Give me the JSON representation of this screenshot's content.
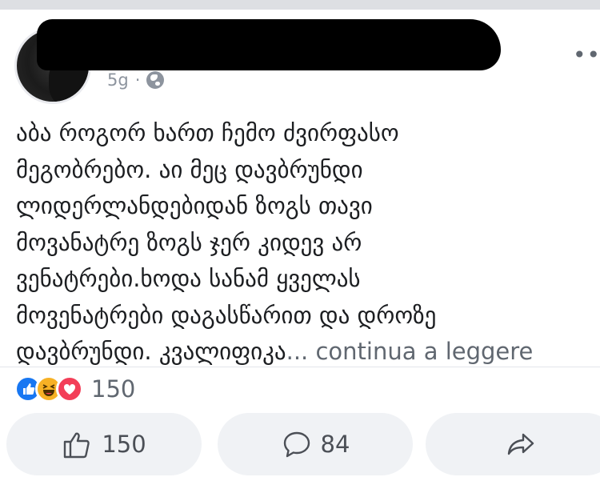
{
  "post": {
    "time": "5g",
    "separator": "·",
    "more_label": "••",
    "text_lines": [
      "აბა როგორ ხართ ჩემო ძვირფასო",
      "მეგობრებო. აი მეც  დავბრუნდი",
      "ლიდერლანდებიდან ზოგს თავი",
      "მოვანატრე ზოგს ჯერ კიდევ არ",
      "ვენატრები.ხოდა სანამ ყველას",
      "მოვენატრები დაგასწარით და დროზე",
      "დავბრუნდი. კვალიფიკა"
    ],
    "ellipsis": "...",
    "see_more": " continua a leggere"
  },
  "reactions": {
    "types": [
      "like-icon",
      "haha-icon",
      "love-icon"
    ],
    "count": "150"
  },
  "actions": {
    "like_count": "150",
    "comment_count": "84"
  },
  "colors": {
    "like": "#1877f2",
    "haha": "#f7b125",
    "love": "#f33e58",
    "muted": "#606770"
  }
}
